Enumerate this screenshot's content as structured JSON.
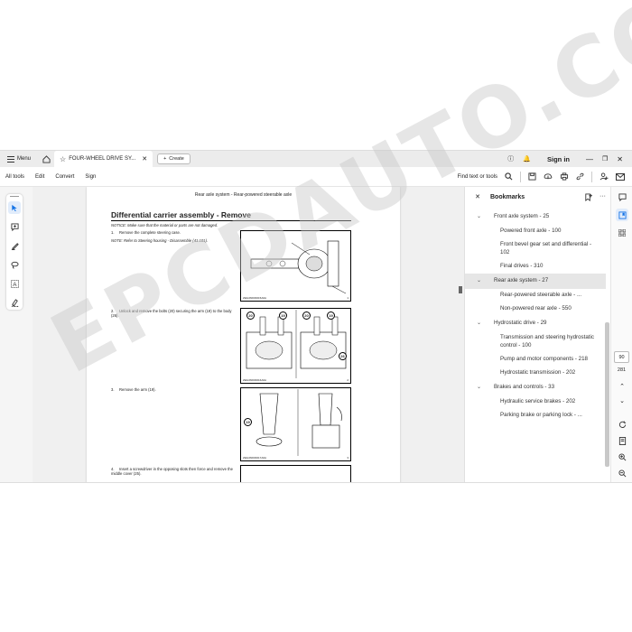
{
  "tabbar": {
    "menu_label": "Menu",
    "tab_title": "FOUR-WHEEL DRIVE SY...",
    "create_label": "Create",
    "signin_label": "Sign in"
  },
  "toolbar": {
    "all_tools": "All tools",
    "edit": "Edit",
    "convert": "Convert",
    "sign": "Sign",
    "find_label": "Find text or tools"
  },
  "document": {
    "header": "Rear axle system - Rear-powered steerable axle",
    "title": "Differential carrier assembly - Remove",
    "notice": "NOTICE: Make sure that the material or parts are not damaged.",
    "steps": [
      {
        "num": "1.",
        "text": "Remove the complete steering case."
      },
      {
        "num": "2.",
        "text": "Unlock and remove the bolts (20) securing the arm (19) to the body (26)."
      },
      {
        "num": "3.",
        "text": "Remove the arm (19)."
      },
      {
        "num": "4.",
        "text": "Insert a screwdriver in the opposing slots then force and remove the middle cover (25)."
      }
    ],
    "note": "NOTE: Refer to Steering housing - Disassemble (41.101).",
    "fig_captions": [
      "ZEIL06FR0015A0A",
      "ZEIL06FR0016A0A",
      "ZEIL06FR0017A0A"
    ],
    "fig_numbers": [
      "1",
      "2",
      "3"
    ],
    "callouts": {
      "c20": "20",
      "c19": "19",
      "c26": "26"
    }
  },
  "bookmarks": {
    "title": "Bookmarks",
    "items": [
      {
        "label": "Front axle system - 25",
        "kind": "parent",
        "expanded": true
      },
      {
        "label": "Powered front axle - 100",
        "kind": "child"
      },
      {
        "label": "Front bevel gear set and differential - 102",
        "kind": "child"
      },
      {
        "label": "Final drives - 310",
        "kind": "child"
      },
      {
        "label": "Rear axle system - 27",
        "kind": "parent",
        "expanded": true,
        "selected": true
      },
      {
        "label": "Rear-powered steerable axle - ...",
        "kind": "child"
      },
      {
        "label": "Non-powered rear axle - 550",
        "kind": "child"
      },
      {
        "label": "Hydrostatic drive - 29",
        "kind": "parent",
        "expanded": true
      },
      {
        "label": "Transmission and steering hydrostatic control - 100",
        "kind": "child"
      },
      {
        "label": "Pump and motor components - 218",
        "kind": "child"
      },
      {
        "label": "Hydrostatic transmission - 202",
        "kind": "child"
      },
      {
        "label": "Brakes and controls - 33",
        "kind": "parent",
        "expanded": true
      },
      {
        "label": "Hydraulic service brakes - 202",
        "kind": "child"
      },
      {
        "label": "Parking brake or parking lock - ...",
        "kind": "child"
      }
    ]
  },
  "pager": {
    "current": "90",
    "total": "281"
  },
  "watermark": "EPCDAUTO.COM",
  "colors": {
    "accent": "#1473e6",
    "selected_bg": "#e6e6e6"
  }
}
